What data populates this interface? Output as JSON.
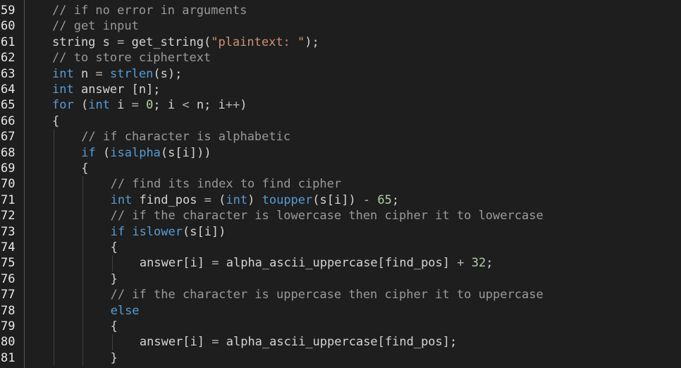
{
  "editor": {
    "lines": [
      {
        "n": "59",
        "indent": 0,
        "tokens": [
          {
            "t": "// if no error in arguments",
            "c": "cm"
          }
        ]
      },
      {
        "n": "60",
        "indent": 0,
        "tokens": [
          {
            "t": "// get input",
            "c": "cm"
          }
        ]
      },
      {
        "n": "61",
        "indent": 0,
        "tokens": [
          {
            "t": "string s ",
            "c": "txt"
          },
          {
            "t": "=",
            "c": "op"
          },
          {
            "t": " get_string(",
            "c": "txt"
          },
          {
            "t": "\"plaintext: \"",
            "c": "str"
          },
          {
            "t": ");",
            "c": "txt"
          }
        ]
      },
      {
        "n": "62",
        "indent": 0,
        "tokens": [
          {
            "t": "// to store ciphertext",
            "c": "cm"
          }
        ]
      },
      {
        "n": "63",
        "indent": 0,
        "tokens": [
          {
            "t": "int",
            "c": "kw"
          },
          {
            "t": " n ",
            "c": "txt"
          },
          {
            "t": "=",
            "c": "op"
          },
          {
            "t": " ",
            "c": "txt"
          },
          {
            "t": "strlen",
            "c": "bfn"
          },
          {
            "t": "(s);",
            "c": "txt"
          }
        ]
      },
      {
        "n": "64",
        "indent": 0,
        "tokens": [
          {
            "t": "int",
            "c": "kw"
          },
          {
            "t": " answer [n];",
            "c": "txt"
          }
        ]
      },
      {
        "n": "65",
        "indent": 0,
        "tokens": [
          {
            "t": "for",
            "c": "kw"
          },
          {
            "t": " (",
            "c": "txt"
          },
          {
            "t": "int",
            "c": "kw"
          },
          {
            "t": " i ",
            "c": "txt"
          },
          {
            "t": "=",
            "c": "op"
          },
          {
            "t": " ",
            "c": "txt"
          },
          {
            "t": "0",
            "c": "num"
          },
          {
            "t": "; i ",
            "c": "txt"
          },
          {
            "t": "<",
            "c": "op"
          },
          {
            "t": " n; i",
            "c": "txt"
          },
          {
            "t": "++",
            "c": "op"
          },
          {
            "t": ")",
            "c": "txt"
          }
        ]
      },
      {
        "n": "66",
        "indent": 0,
        "tokens": [
          {
            "t": "{",
            "c": "txt"
          }
        ]
      },
      {
        "n": "67",
        "indent": 1,
        "tokens": [
          {
            "t": "// if character is alphabetic",
            "c": "cm"
          }
        ]
      },
      {
        "n": "68",
        "indent": 1,
        "tokens": [
          {
            "t": "if",
            "c": "kw"
          },
          {
            "t": " (",
            "c": "txt"
          },
          {
            "t": "isalpha",
            "c": "bfn"
          },
          {
            "t": "(s[i]))",
            "c": "txt"
          }
        ]
      },
      {
        "n": "69",
        "indent": 1,
        "tokens": [
          {
            "t": "{",
            "c": "txt"
          }
        ]
      },
      {
        "n": "70",
        "indent": 2,
        "tokens": [
          {
            "t": "// find its index to find cipher",
            "c": "cm"
          }
        ]
      },
      {
        "n": "71",
        "indent": 2,
        "tokens": [
          {
            "t": "int",
            "c": "kw"
          },
          {
            "t": " find_pos ",
            "c": "txt"
          },
          {
            "t": "=",
            "c": "op"
          },
          {
            "t": " (",
            "c": "txt"
          },
          {
            "t": "int",
            "c": "kw"
          },
          {
            "t": ") ",
            "c": "txt"
          },
          {
            "t": "toupper",
            "c": "bfn"
          },
          {
            "t": "(s[i]) ",
            "c": "txt"
          },
          {
            "t": "-",
            "c": "op"
          },
          {
            "t": " ",
            "c": "txt"
          },
          {
            "t": "65",
            "c": "num"
          },
          {
            "t": ";",
            "c": "txt"
          }
        ]
      },
      {
        "n": "72",
        "indent": 2,
        "tokens": [
          {
            "t": "// if the character is lowercase then cipher it to lowercase",
            "c": "cm"
          }
        ]
      },
      {
        "n": "73",
        "indent": 2,
        "tokens": [
          {
            "t": "if",
            "c": "kw"
          },
          {
            "t": " ",
            "c": "txt"
          },
          {
            "t": "islower",
            "c": "bfn"
          },
          {
            "t": "(s[i])",
            "c": "txt"
          }
        ]
      },
      {
        "n": "74",
        "indent": 2,
        "tokens": [
          {
            "t": "{",
            "c": "txt"
          }
        ]
      },
      {
        "n": "75",
        "indent": 3,
        "tokens": [
          {
            "t": "answer[i] ",
            "c": "txt"
          },
          {
            "t": "=",
            "c": "op"
          },
          {
            "t": " alpha_ascii_uppercase[find_pos] ",
            "c": "txt"
          },
          {
            "t": "+",
            "c": "op"
          },
          {
            "t": " ",
            "c": "txt"
          },
          {
            "t": "32",
            "c": "num"
          },
          {
            "t": ";",
            "c": "txt"
          }
        ]
      },
      {
        "n": "76",
        "indent": 2,
        "tokens": [
          {
            "t": "}",
            "c": "txt"
          }
        ]
      },
      {
        "n": "77",
        "indent": 2,
        "tokens": [
          {
            "t": "// if the character is uppercase then cipher it to uppercase",
            "c": "cm"
          }
        ]
      },
      {
        "n": "78",
        "indent": 2,
        "tokens": [
          {
            "t": "else",
            "c": "kw"
          }
        ]
      },
      {
        "n": "79",
        "indent": 2,
        "tokens": [
          {
            "t": "{",
            "c": "txt"
          }
        ]
      },
      {
        "n": "80",
        "indent": 3,
        "tokens": [
          {
            "t": "answer[i] ",
            "c": "txt"
          },
          {
            "t": "=",
            "c": "op"
          },
          {
            "t": " alpha_ascii_uppercase[find_pos];",
            "c": "txt"
          }
        ]
      },
      {
        "n": "81",
        "indent": 2,
        "tokens": [
          {
            "t": "}",
            "c": "txt"
          }
        ]
      }
    ]
  },
  "theme": {
    "background": "#1e1e1e",
    "keyword": "#569cd6",
    "string": "#ce9178",
    "number": "#b5cea8",
    "comment": "#9a9a9a",
    "text": "#d4d4d4",
    "line_number": "#e8e8e8"
  }
}
